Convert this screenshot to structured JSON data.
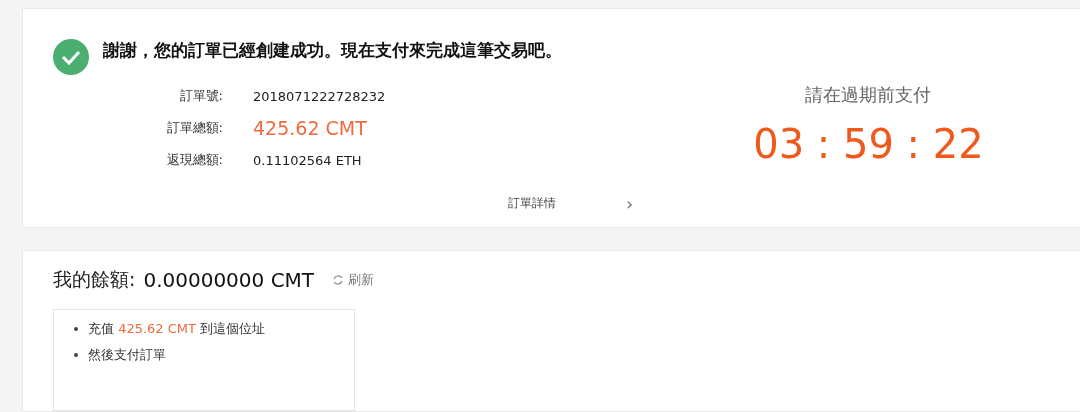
{
  "order_card": {
    "success": true,
    "message": "謝謝，您的訂單已經創建成功。現在支付來完成這筆交易吧。",
    "fields": [
      {
        "label": "訂單號:",
        "value": "2018071222728232",
        "kind": "plain"
      },
      {
        "label": "訂單總額:",
        "value": "425.62 CMT",
        "kind": "highlight"
      },
      {
        "label": "返現總額:",
        "value": "0.11102564 ETH",
        "kind": "plain"
      }
    ],
    "details_link": "訂單詳情",
    "chevron": "›",
    "deadline_label": "請在過期前支付",
    "countdown": "03 : 59 : 22"
  },
  "balance_card": {
    "label": "我的餘額:",
    "amount": "0.00000000 CMT",
    "refresh": "刷新",
    "steps": [
      {
        "before": "充值 ",
        "amount": "425.62 CMT",
        "after": " 到這個位址"
      },
      {
        "before": "然後支付訂單"
      }
    ]
  }
}
